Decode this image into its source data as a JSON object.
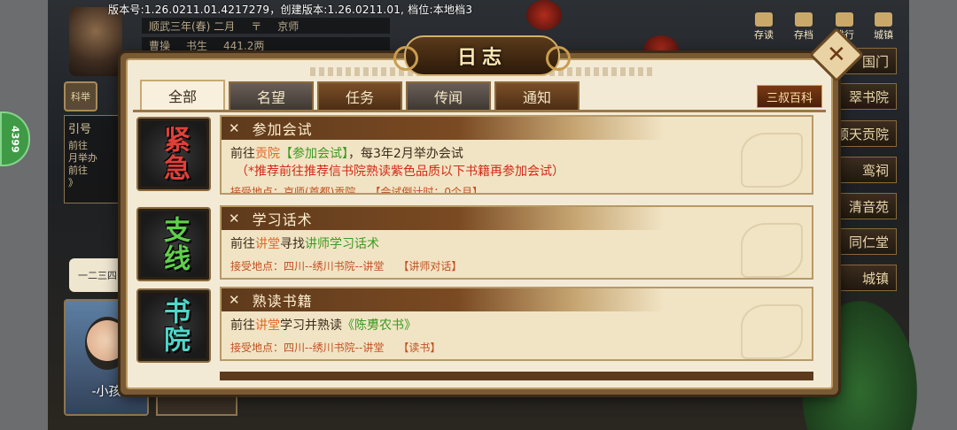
{
  "version_bar": "版本号:1.26.0211.01.4217279，创建版本:1.26.0211.01, 档位:本地档3",
  "background": {
    "date_row": {
      "date": "顺武三年(春) 二月",
      "mark": "〒",
      "city": "京师"
    },
    "stats_row": {
      "name": "曹操",
      "rank": "书生",
      "money": "441.2两"
    },
    "left_badge": "科举",
    "side_counter": "4399",
    "guide_panel": {
      "title": "引号",
      "lines": [
        "前往",
        "月举办",
        "前往",
        "》"
      ]
    },
    "index_pill": "一二三四",
    "child_name": "-小孩",
    "top_icons": [
      {
        "label": "存读",
        "icon": "scroll-icon"
      },
      {
        "label": "存档",
        "icon": "save-icon"
      },
      {
        "label": "排行",
        "icon": "rank-icon"
      },
      {
        "label": "城镇",
        "icon": "town-icon"
      }
    ],
    "buildings": [
      "国门",
      "翠书院",
      "顺天贡院",
      "鸾祠",
      "清音苑",
      "同仁堂",
      "城镇"
    ]
  },
  "dialog": {
    "title": "日志",
    "close_symbol": "✕",
    "tabs": [
      {
        "label": "全部",
        "active": true
      },
      {
        "label": "名望",
        "active": false
      },
      {
        "label": "任务",
        "active": false
      },
      {
        "label": "传闻",
        "active": false
      },
      {
        "label": "通知",
        "active": false
      }
    ],
    "wiki_button": "三叔百科",
    "quests": [
      {
        "badge": "紧急",
        "badge_color": "#e0403a",
        "x_mark": "✕",
        "title": "参加会试",
        "desc_prefix": "前往",
        "desc_place": "贡院",
        "desc_highlight": "【参加会试】",
        "desc_suffix": "，每3年2月举办会试",
        "note": "（*推荐前往推荐信书院熟读紫色品质以下书籍再参加会试）",
        "loc_label": "接受地点：京师(首都)贡院",
        "loc_tag": "【会试倒计时：0个月】"
      },
      {
        "badge": "支线",
        "badge_color": "#5fd04a",
        "x_mark": "✕",
        "title": "学习话术",
        "desc_prefix": "前往",
        "desc_place": "讲堂",
        "desc_mid": "寻找",
        "desc_highlight": "讲师学习话术",
        "loc_label": "接受地点：四川--绣川书院--讲堂",
        "loc_tag": "【讲师对话】"
      },
      {
        "badge": "书院",
        "badge_color": "#4fd6c8",
        "x_mark": "✕",
        "title": "熟读书籍",
        "desc_prefix": "前往",
        "desc_place": "讲堂",
        "desc_mid": "学习并熟读",
        "desc_highlight": "《陈旉农书》",
        "loc_label": "接受地点：四川--绣川书院--讲堂",
        "loc_tag": "【读书】"
      }
    ]
  }
}
